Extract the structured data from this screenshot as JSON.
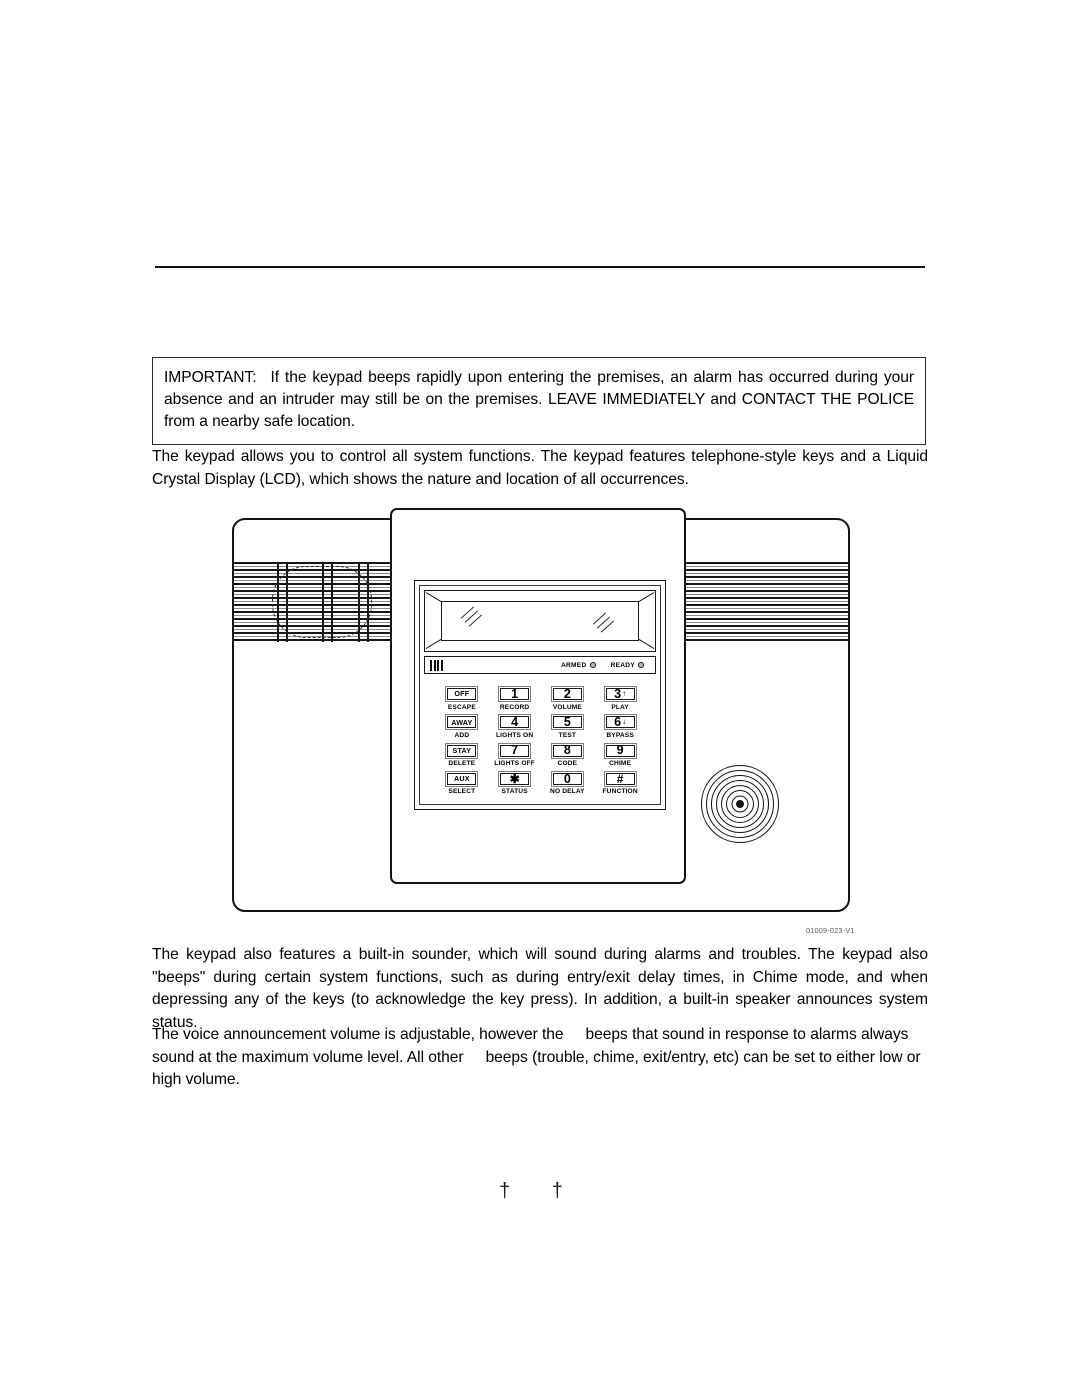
{
  "page": {
    "important_box": {
      "lead": "IMPORTANT:",
      "text": "If the keypad beeps rapidly upon entering the premises, an alarm has occurred during your absence and an intruder may still be on the premises. LEAVE IMMEDIATELY and CONTACT THE POLICE from a nearby safe location."
    },
    "paragraph_intro": "The keypad allows you to control all system functions. The keypad features telephone-style keys and a Liquid Crystal Display (LCD), which shows the nature and location of all occurrences.",
    "paragraph_sounder": "The keypad also features a built-in sounder, which will sound during alarms and troubles. The keypad also \"beeps\" during certain system functions, such as during entry/exit delay times, in Chime mode, and when depressing any of the keys (to acknowledge the key press). In addition, a built-in speaker announces system status.",
    "paragraph_volume": {
      "part1": "The voice announcement volume is adjustable, however the",
      "part2": "beeps  that sound in response to alarms always sound at the maximum volume level. All other",
      "part3": "beeps  (trouble, chime, exit/entry, etc) can be set to either low or high volume."
    },
    "figure_id": "01009-023-V1",
    "footer_marks": "† †"
  },
  "keypad": {
    "indicators": [
      {
        "label": "ARMED"
      },
      {
        "label": "READY"
      }
    ],
    "contrast_bar_count": 4,
    "keys": [
      {
        "face": "OFF",
        "type": "word",
        "label": "ESCAPE",
        "arrow": ""
      },
      {
        "face": "1",
        "type": "num",
        "label": "RECORD",
        "arrow": ""
      },
      {
        "face": "2",
        "type": "num",
        "label": "VOLUME",
        "arrow": ""
      },
      {
        "face": "3",
        "type": "num",
        "label": "PLAY",
        "arrow": "↑"
      },
      {
        "face": "AWAY",
        "type": "word",
        "label": "ADD",
        "arrow": ""
      },
      {
        "face": "4",
        "type": "num",
        "label": "LIGHTS ON",
        "arrow": ""
      },
      {
        "face": "5",
        "type": "num",
        "label": "TEST",
        "arrow": ""
      },
      {
        "face": "6",
        "type": "num",
        "label": "BYPASS",
        "arrow": "↓"
      },
      {
        "face": "STAY",
        "type": "word",
        "label": "DELETE",
        "arrow": ""
      },
      {
        "face": "7",
        "type": "num",
        "label": "LIGHTS OFF",
        "arrow": ""
      },
      {
        "face": "8",
        "type": "num",
        "label": "CODE",
        "arrow": ""
      },
      {
        "face": "9",
        "type": "num",
        "label": "CHIME",
        "arrow": ""
      },
      {
        "face": "AUX",
        "type": "word",
        "label": "SELECT",
        "arrow": ""
      },
      {
        "face": "✱",
        "type": "sym",
        "label": "STATUS",
        "arrow": ""
      },
      {
        "face": "0",
        "type": "num",
        "label": "NO DELAY",
        "arrow": ""
      },
      {
        "face": "#",
        "type": "sym",
        "label": "FUNCTION",
        "arrow": ""
      }
    ]
  },
  "colors": {
    "ink": "#000000",
    "paper": "#ffffff",
    "rule": "#111111",
    "key_border": "#808080"
  }
}
